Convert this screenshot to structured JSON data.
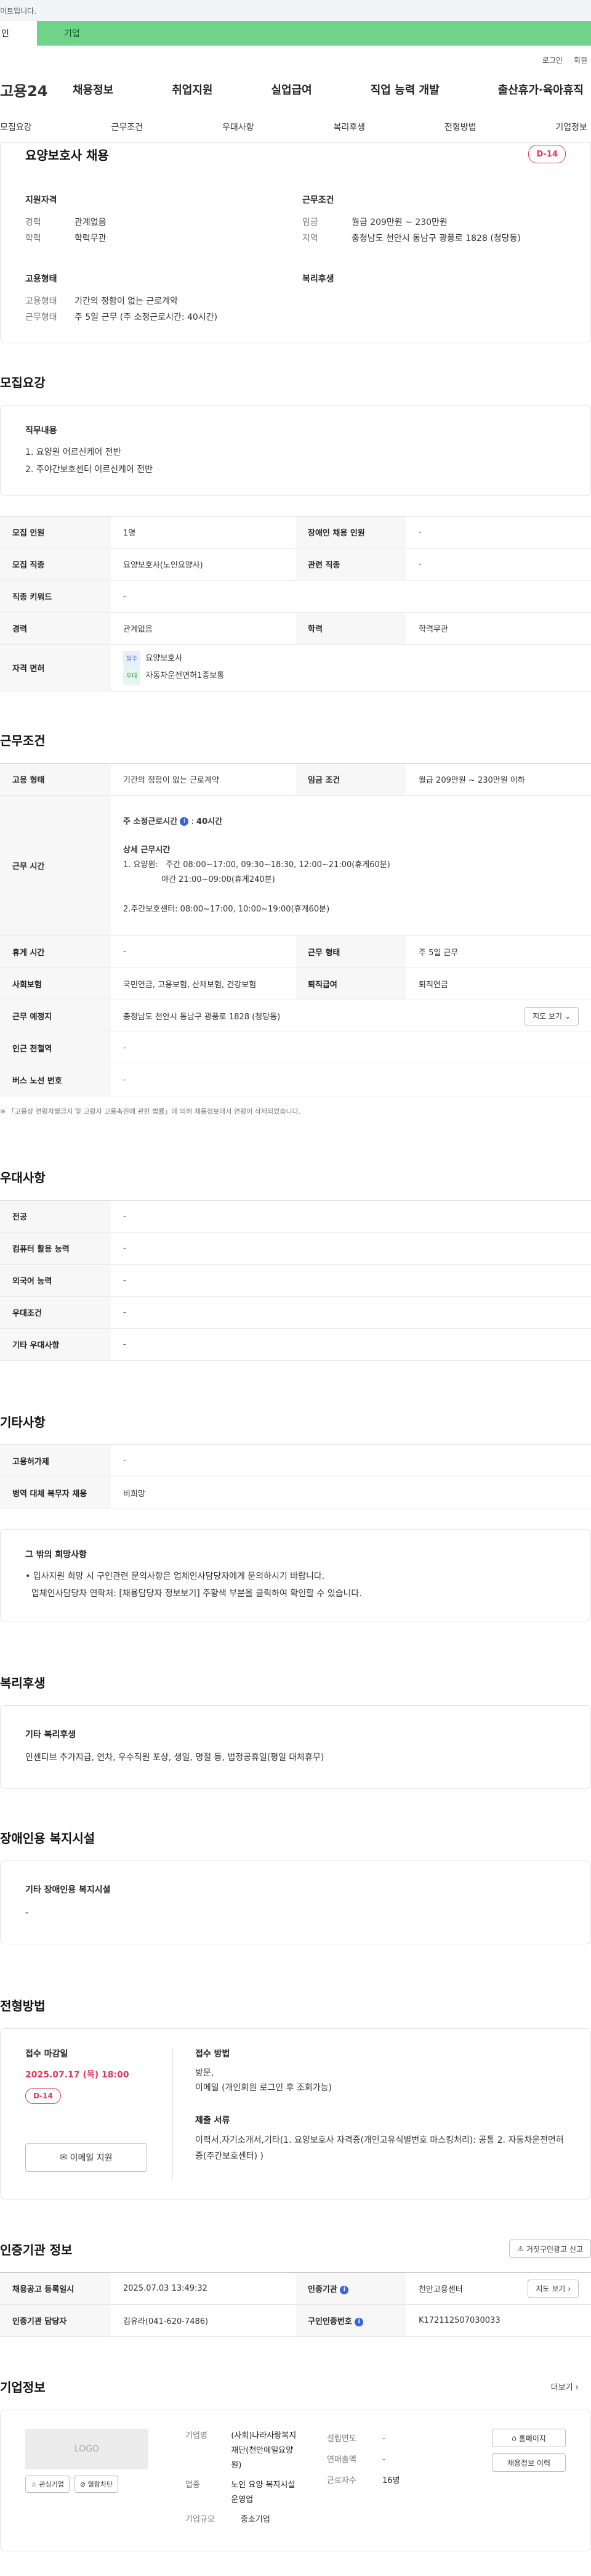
{
  "topbar": {
    "notice": "이트입니다."
  },
  "tabs": {
    "first": "인",
    "second": "기업"
  },
  "util": {
    "login": "로그인",
    "signup": "회원"
  },
  "gnb": {
    "logo": "고용24",
    "menu": [
      "채용정보",
      "취업지원",
      "실업급여",
      "직업 능력 개발",
      "출산휴가·육아휴직"
    ]
  },
  "subnav": [
    "모집요강",
    "근무조건",
    "우대사항",
    "복리후생",
    "전형방법",
    "기업정보"
  ],
  "summary": {
    "title": "요양보호사 채용",
    "dday": "D-14",
    "qual_title": "지원자격",
    "career_k": "경력",
    "career_v": "관계없음",
    "edu_k": "학력",
    "edu_v": "학력무관",
    "cond_title": "근무조건",
    "wage_k": "임금",
    "wage_v": "월급 209만원 ~ 230만원",
    "region_k": "지역",
    "region_v": "충청남도 천안시 동남구 광풍로 1828 (청당동)",
    "type_title": "고용형태",
    "emp_k": "고용형태",
    "emp_v": "기간의 정함이 없는 근로계약",
    "work_k": "근무형태",
    "work_v": "주 5일 근무 (주 소정근로시간: 40시간)",
    "welfare_title": "복리후생"
  },
  "recruit": {
    "heading": "모집요강",
    "duty_title": "직무내용",
    "duties": [
      "1. 요양원 어르신케어 전반",
      "2. 주야간보호센터 어르신케어 전반"
    ],
    "rows": [
      [
        "모집 인원",
        "1명",
        "장애인 채용 인원",
        "-"
      ],
      [
        "모집 직종",
        "요양보호사(노인요양사)",
        "관련 직종",
        "-"
      ]
    ],
    "keyword_k": "직종 키워드",
    "keyword_v": "-",
    "career_k": "경력",
    "career_v": "관계없음",
    "edu_k": "학력",
    "edu_v": "학력무관",
    "license_k": "자격 면허",
    "lic1_tag": "필수",
    "lic1": "요양보호사",
    "lic2_tag": "우대",
    "lic2": "자동차운전면허1종보통"
  },
  "work": {
    "heading": "근무조건",
    "emp_k": "고용 형태",
    "emp_v": "기간의 정함이 없는 근로계약",
    "wage_k": "임금 조건",
    "wage_v": "월급 209만원 ~ 230만원 이하",
    "time_k": "근무 시간",
    "time_main": "주 소정근로시간",
    "time_hours": "40시간",
    "time_detail_title": "상세 근무시간",
    "time_lines": [
      "1. 요양원:   주간 08:00~17:00, 09:30~18:30, 12:00~21:00(휴게60분)",
      "               야간 21:00~09:00(휴게240분)",
      "",
      "2.주간보호센터: 08:00~17:00, 10:00~19:00(휴게60분)"
    ],
    "rest_k": "휴게 시간",
    "rest_v": "-",
    "form_k": "근무 형태",
    "form_v": "주 5일 근무",
    "ins_k": "사회보험",
    "ins_v": "국민연금, 고용보험, 산재보험, 건강보험",
    "sev_k": "퇴직급여",
    "sev_v": "퇴직연금",
    "place_k": "근무 예정지",
    "place_v": "충청남도 천안시 동남구 광풍로 1828 (청당동)",
    "map_btn": "지도 보기",
    "subway_k": "인근 전철역",
    "subway_v": "-",
    "bus_k": "버스 노선 번호",
    "bus_v": "-",
    "footnote": "「고용상 연령차별금지 및 고령자 고용촉진에 관한 법률」에 의해 채용정보에서 연령이 삭제되었습니다."
  },
  "pref": {
    "heading": "우대사항",
    "rows": [
      [
        "전공",
        "-"
      ],
      [
        "컴퓨터 활용 능력",
        "-"
      ],
      [
        "외국어 능력",
        "-"
      ],
      [
        "우대조건",
        "-"
      ],
      [
        "기타 우대사항",
        "-"
      ]
    ]
  },
  "etc": {
    "heading": "기타사항",
    "rows": [
      [
        "고용허가제",
        "-"
      ],
      [
        "병역 대체 복무자 채용",
        "비희망"
      ]
    ],
    "box_title": "그 밖의 희망사항",
    "box_lines": [
      "• 입사지원 희망 시 구인관련 문의사항은 업체인사담당자에게 문의하시기 바랍니다.",
      "업체인사담당자 연락처: [채용담당자 정보보기] 주황색 부분을 클릭하여 확인할 수 있습니다."
    ]
  },
  "welfare": {
    "heading": "복리후생",
    "box_title": "기타 복리후생",
    "box_text": "인센티브 추가지급, 연차, 우수직원 포상, 생일, 명절 등, 법정공휴일(평일 대체휴무)"
  },
  "disability": {
    "heading": "장애인용 복지시설",
    "box_title": "기타 장애인용 복지시설",
    "box_text": "-"
  },
  "selection": {
    "heading": "전형방법",
    "deadline_title": "접수 마감일",
    "deadline": "2025.07.17 (목) 18:00",
    "dday": "D-14",
    "email_btn": "이메일 지원",
    "method_title": "접수 방법",
    "method_lines": [
      "방문,",
      "이메일 (개인회원 로그인 후 조회가능)"
    ],
    "docs_title": "제출 서류",
    "docs_text": "이력서,자기소개서,기타(1. 요양보호사 자격증(개인고유식별번호 마스킹처리): 공통 2. 자동차운전면허증(주간보호센터) )"
  },
  "cert": {
    "heading": "인증기관 정보",
    "report_btn": "거짓구인광고 신고",
    "reg_k": "채용공고 등록일시",
    "reg_v": "2025.07.03 13:49:32",
    "org_k": "인증기관",
    "org_v": "천안고용센터",
    "map_btn": "지도 보기",
    "mgr_k": "인증기관 담당자",
    "mgr_v": "김유라(041-620-7486)",
    "num_k": "구인인증번호",
    "num_v": "K172112507030033"
  },
  "company": {
    "heading": "기업정보",
    "more": "더보기",
    "logo": "LOGO",
    "fav_btn": "관심기업",
    "block_btn": "열람차단",
    "name_k": "기업명",
    "name_v": "(사회)나라사랑복지재단(천안예일요양원)",
    "industry_k": "업종",
    "industry_v": "노인 요양 복지시설 운영업",
    "size_k": "기업규모",
    "size_v": "중소기업",
    "year_k": "설립연도",
    "year_v": "-",
    "sales_k": "연매출액",
    "sales_v": "-",
    "staff_k": "근로자수",
    "staff_v": "16명",
    "home_btn": "홈페이지",
    "jobs_btn": "채용정보 이력"
  }
}
